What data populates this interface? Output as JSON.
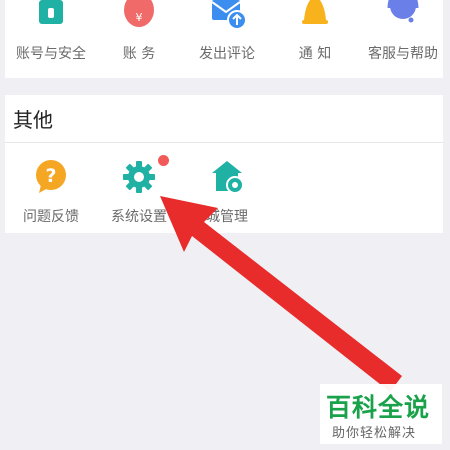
{
  "top_row": {
    "items": [
      {
        "label": "账号与安全",
        "icon": "lock-icon",
        "color": "#1fb1a4"
      },
      {
        "label": "账 务",
        "icon": "money-bag-icon",
        "color": "#f06a6a"
      },
      {
        "label": "发出评论",
        "icon": "envelope-upload-icon",
        "color": "#3b8df0"
      },
      {
        "label": "通 知",
        "icon": "bell-icon",
        "color": "#f7b21c"
      },
      {
        "label": "客服与帮助",
        "icon": "headset-icon",
        "color": "#6b7fe8"
      }
    ]
  },
  "other_section": {
    "title": "其他",
    "items": [
      {
        "label": "问题反馈",
        "icon": "question-bubble-icon",
        "color": "#f5a623"
      },
      {
        "label": "系统设置",
        "icon": "gear-icon",
        "color": "#1fb1a4",
        "badge": true
      },
      {
        "label": "城管理",
        "icon": "house-gear-icon",
        "color": "#1fb1a4"
      }
    ]
  },
  "watermark": {
    "title": "百科全说",
    "subtitle": "助你轻松解决"
  },
  "colors": {
    "badge": "#f25a5a",
    "arrow": "#e82b2b",
    "watermark_green": "#1aa24a"
  }
}
